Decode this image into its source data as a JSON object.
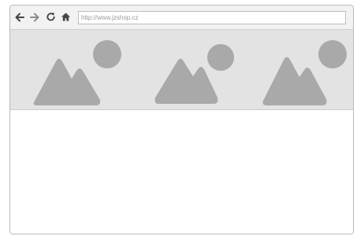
{
  "toolbar": {
    "back_icon": "arrow-left-icon",
    "forward_icon": "arrow-right-icon",
    "reload_icon": "reload-icon",
    "home_icon": "home-icon"
  },
  "address_bar": {
    "url": "http://www.jzshop.cz"
  },
  "banner": {
    "image_placeholders": [
      {
        "icon": "image-placeholder-icon"
      },
      {
        "icon": "image-placeholder-icon"
      },
      {
        "icon": "image-placeholder-icon"
      }
    ]
  },
  "colors": {
    "toolbar_bg": "#f2f2f2",
    "banner_bg": "#e3e3e3",
    "placeholder_gray": "#a9a9a9",
    "border_gray": "#b9b9b9"
  }
}
